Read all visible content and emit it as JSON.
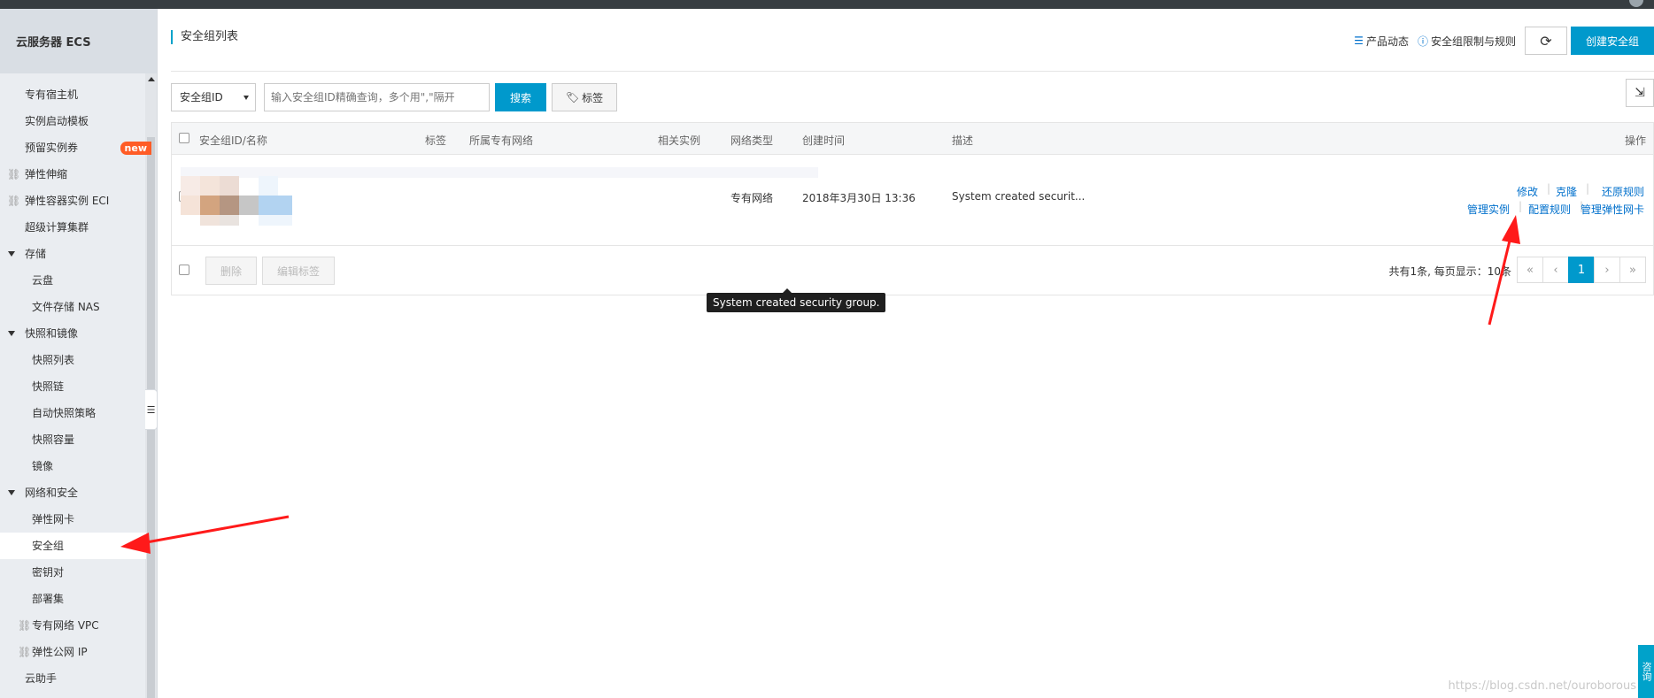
{
  "sidebar": {
    "title": "云服务器 ECS",
    "items": [
      {
        "label": "专有宿主机",
        "level": 1
      },
      {
        "label": "实例启动模板",
        "level": 1
      },
      {
        "label": "预留实例券",
        "level": 1,
        "badge": "new"
      },
      {
        "label": "弹性伸缩",
        "level": 1,
        "icon": "link-icon"
      },
      {
        "label": "弹性容器实例 ECI",
        "level": 1,
        "icon": "link-icon"
      },
      {
        "label": "超级计算集群",
        "level": 1
      },
      {
        "label": "存储",
        "level": 1,
        "group": true
      },
      {
        "label": "云盘",
        "level": 2
      },
      {
        "label": "文件存储 NAS",
        "level": 2
      },
      {
        "label": "快照和镜像",
        "level": 1,
        "group": true
      },
      {
        "label": "快照列表",
        "level": 2
      },
      {
        "label": "快照链",
        "level": 2
      },
      {
        "label": "自动快照策略",
        "level": 2
      },
      {
        "label": "快照容量",
        "level": 2
      },
      {
        "label": "镜像",
        "level": 2
      },
      {
        "label": "网络和安全",
        "level": 1,
        "group": true
      },
      {
        "label": "弹性网卡",
        "level": 2
      },
      {
        "label": "安全组",
        "level": 2,
        "active": true
      },
      {
        "label": "密钥对",
        "level": 2
      },
      {
        "label": "部署集",
        "level": 2
      },
      {
        "label": "专有网络 VPC",
        "level": 2,
        "icon": "link-icon"
      },
      {
        "label": "弹性公网 IP",
        "level": 2,
        "icon": "link-icon"
      },
      {
        "label": "云助手",
        "level": 1
      }
    ]
  },
  "header": {
    "title": "安全组列表",
    "news_link": "产品动态",
    "limits_link": "安全组限制与规则",
    "create_button": "创建安全组"
  },
  "toolbar": {
    "filter_select": "安全组ID",
    "search_placeholder": "输入安全组ID精确查询，多个用\",\"隔开",
    "search_button": "搜索",
    "tag_button": "标签"
  },
  "table": {
    "columns": [
      "安全组ID/名称",
      "标签",
      "所属专有网络",
      "相关实例",
      "网络类型",
      "创建时间",
      "描述",
      "操作"
    ],
    "rows": [
      {
        "network_type": "专有网络",
        "created": "2018年3月30日 13:36",
        "description": "System created securit...",
        "actions": [
          "修改",
          "克隆",
          "还原规则",
          "管理实例",
          "配置规则",
          "管理弹性网卡"
        ]
      }
    ],
    "footer": {
      "delete_button": "删除",
      "edit_tags_button": "编辑标签",
      "summary": "共有1条, 每页显示：10条",
      "pages": [
        "«",
        "‹",
        "1",
        "›",
        "»"
      ],
      "current_page": "1"
    }
  },
  "tooltip": "System created security group.",
  "watermark": "https://blog.csdn.net/ouroborous",
  "consult": "咨询",
  "colors": {
    "accent": "#0099cc",
    "link": "#0070cc",
    "annotation_arrow": "#ff1a1a",
    "new_badge": "#ff5c26"
  }
}
